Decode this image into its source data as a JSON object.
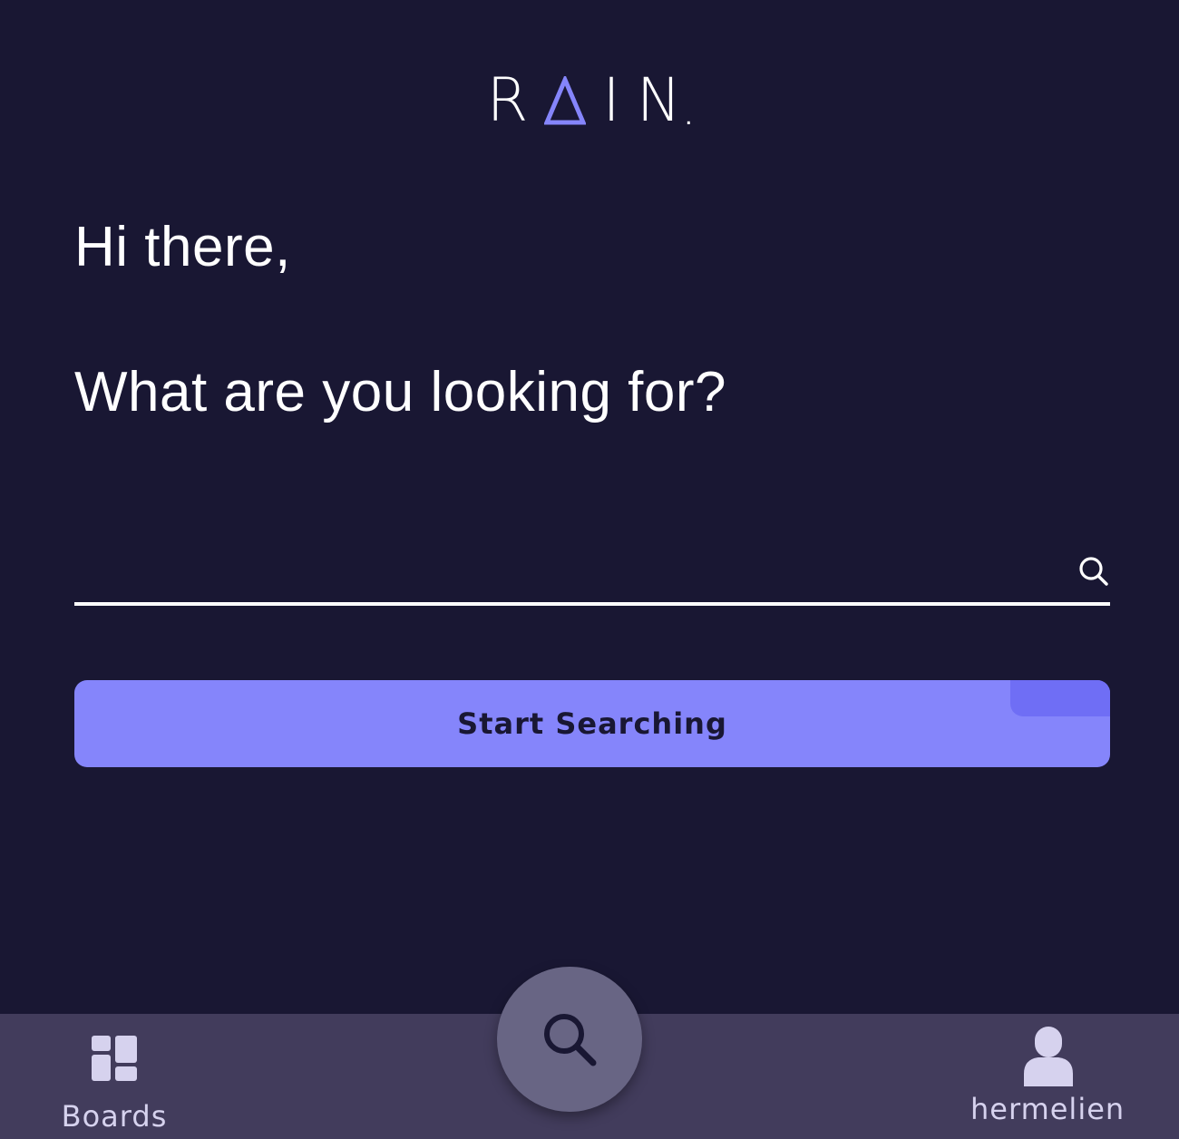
{
  "app": {
    "logo_text": "RAIN.",
    "accent_color": "#8585fb",
    "background_color": "#191733",
    "nav_background_color": "#423c5c"
  },
  "main": {
    "greeting": "Hi there,",
    "question": "What are you looking for?",
    "search": {
      "value": "",
      "placeholder": "",
      "icon": "search-icon"
    },
    "start_button_label": "Start Searching"
  },
  "bottom_nav": {
    "items": [
      {
        "label": "Boards",
        "icon": "boards-icon"
      },
      {
        "label": "",
        "icon": "search-icon"
      },
      {
        "label": "hermelien",
        "icon": "user-icon"
      }
    ]
  }
}
